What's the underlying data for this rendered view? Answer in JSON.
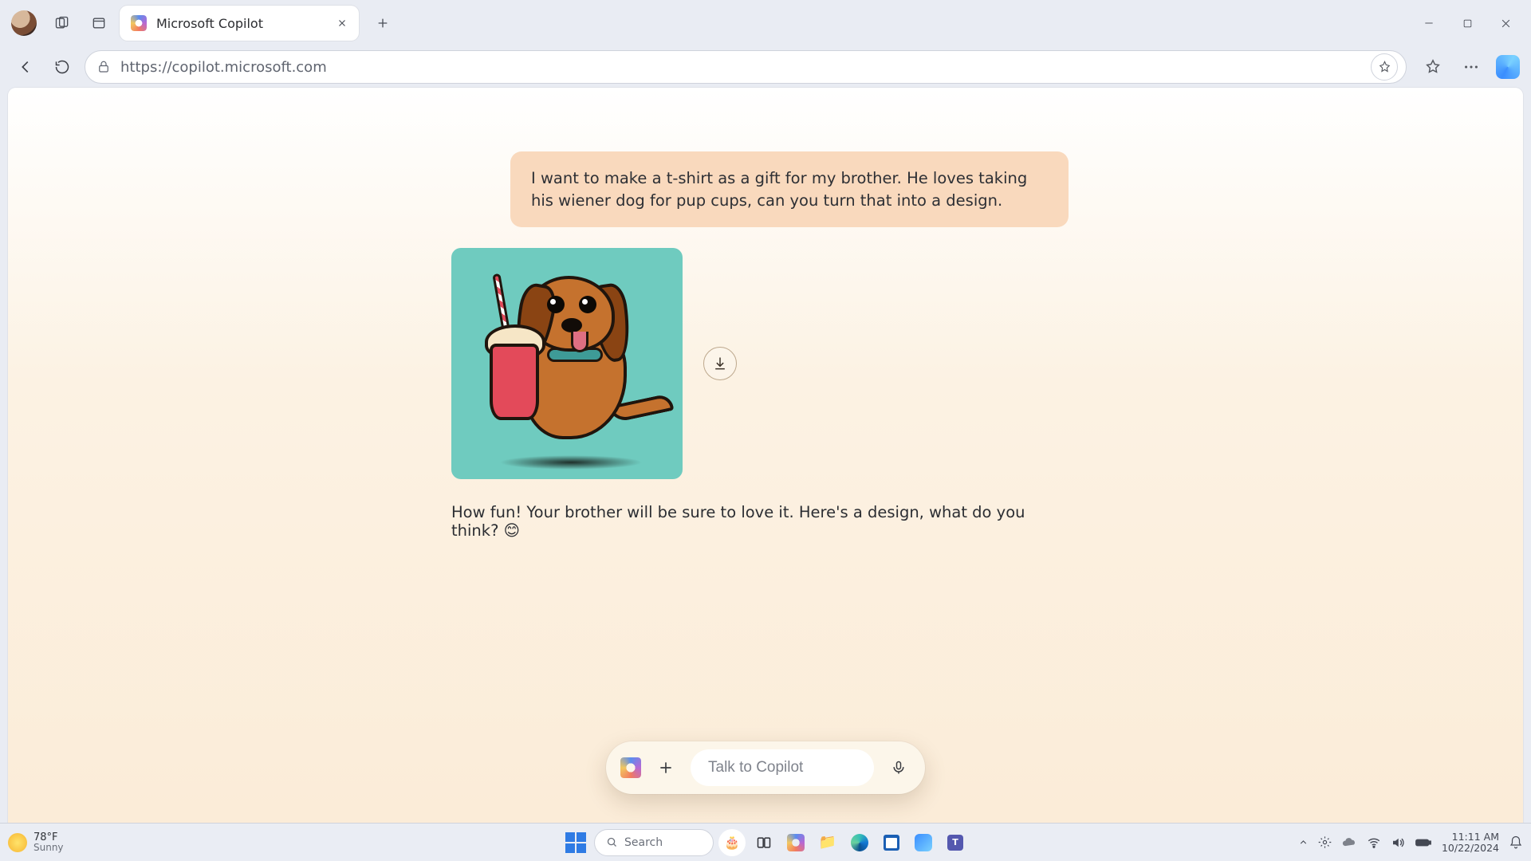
{
  "browser": {
    "tab_title": "Microsoft Copilot",
    "url": "https://copilot.microsoft.com"
  },
  "chat": {
    "user_prompt": "I want to make a t-shirt as a gift for my brother. He loves taking his wiener dog for pup cups, can you turn that into a design.",
    "assistant_reply": "How fun! Your brother will be sure to love it. Here's a design, what do you think? 😊",
    "image_alt": "Cartoon wiener dog holding a pup cup with whipped cream and straw on turquoise background"
  },
  "compose": {
    "placeholder": "Talk to Copilot"
  },
  "taskbar": {
    "temp": "78°F",
    "condition": "Sunny",
    "search_placeholder": "Search",
    "time": "11:11 AM",
    "date": "10/22/2024"
  }
}
